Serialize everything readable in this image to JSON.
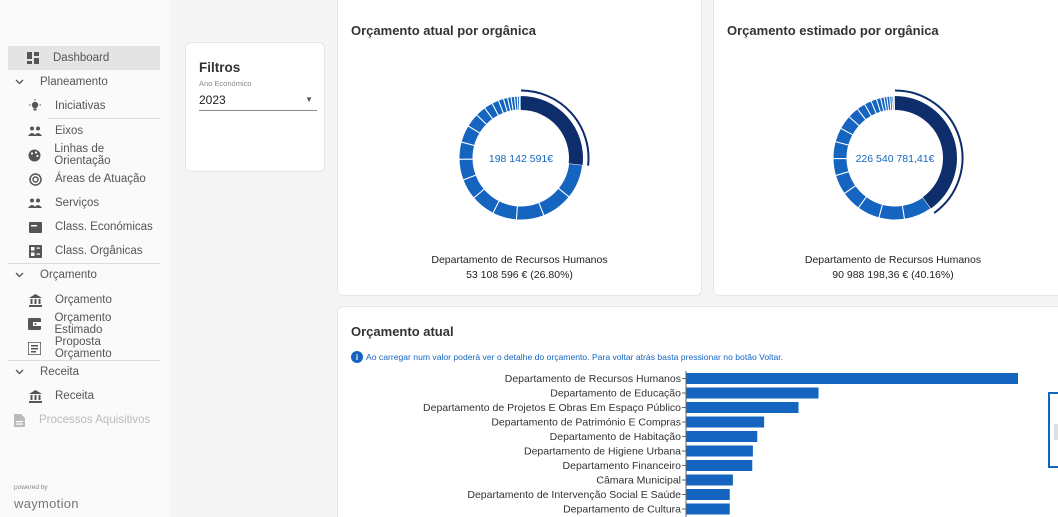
{
  "sidebar": {
    "dashboard": "Dashboard",
    "groups": {
      "planeamento": "Planeamento",
      "orcamento": "Orçamento",
      "receita": "Receita"
    },
    "items": {
      "iniciativas": "Iniciativas",
      "eixos": "Eixos",
      "linhas": "Linhas de Orientação",
      "areas": "Áreas de Atuação",
      "servicos": "Serviços",
      "class_economicas": "Class. Económicas",
      "class_organicas": "Class. Orgânicas",
      "orcamento": "Orçamento",
      "orcamento_estimado": "Orçamento Estimado",
      "proposta": "Proposta Orçamento",
      "receita": "Receita",
      "processos": "Processos Aquisitivos"
    },
    "powered_by": "powered by",
    "logo_text": "waymotion"
  },
  "filters": {
    "title": "Filtros",
    "year_label": "Ano Económico",
    "year_value": "2023"
  },
  "card_atual": {
    "title": "Orçamento atual por orgânica",
    "center_value": "198 142 591€",
    "dept": "Departamento de Recursos Humanos",
    "detail": "53 108 596 € (26.80%)",
    "highlight_percent": 26.8
  },
  "card_estimado": {
    "title": "Orçamento estimado por orgânica",
    "center_value": "226 540 781,41€",
    "dept": "Departamento de Recursos Humanos",
    "detail": "90 988 198,36 € (40.16%)",
    "highlight_percent": 40.16
  },
  "bar_card": {
    "title": "Orçamento atual",
    "info": "Ao carregar num valor poderá ver o detalhe do orçamento. Para voltar atrás basta pressionar no botão Voltar."
  },
  "colors": {
    "primary": "#1565c0",
    "dark": "#0d2d6b",
    "bar": "#1565c0"
  },
  "chart_data": {
    "type": "bar",
    "orientation": "horizontal",
    "categories": [
      "Departamento de Recursos Humanos",
      "Departamento de Educação",
      "Departamento de Projetos E Obras Em Espaço Público",
      "Departamento de Património E Compras",
      "Departamento de Habitação",
      "Departamento de Higiene Urbana",
      "Departamento Financeiro",
      "Câmara Municipal",
      "Departamento de Intervenção Social E Saúde",
      "Departamento de Cultura"
    ],
    "values": [
      53108596,
      21200000,
      18000000,
      12500000,
      11400000,
      10700000,
      10600000,
      7500000,
      7000000,
      7000000
    ]
  }
}
